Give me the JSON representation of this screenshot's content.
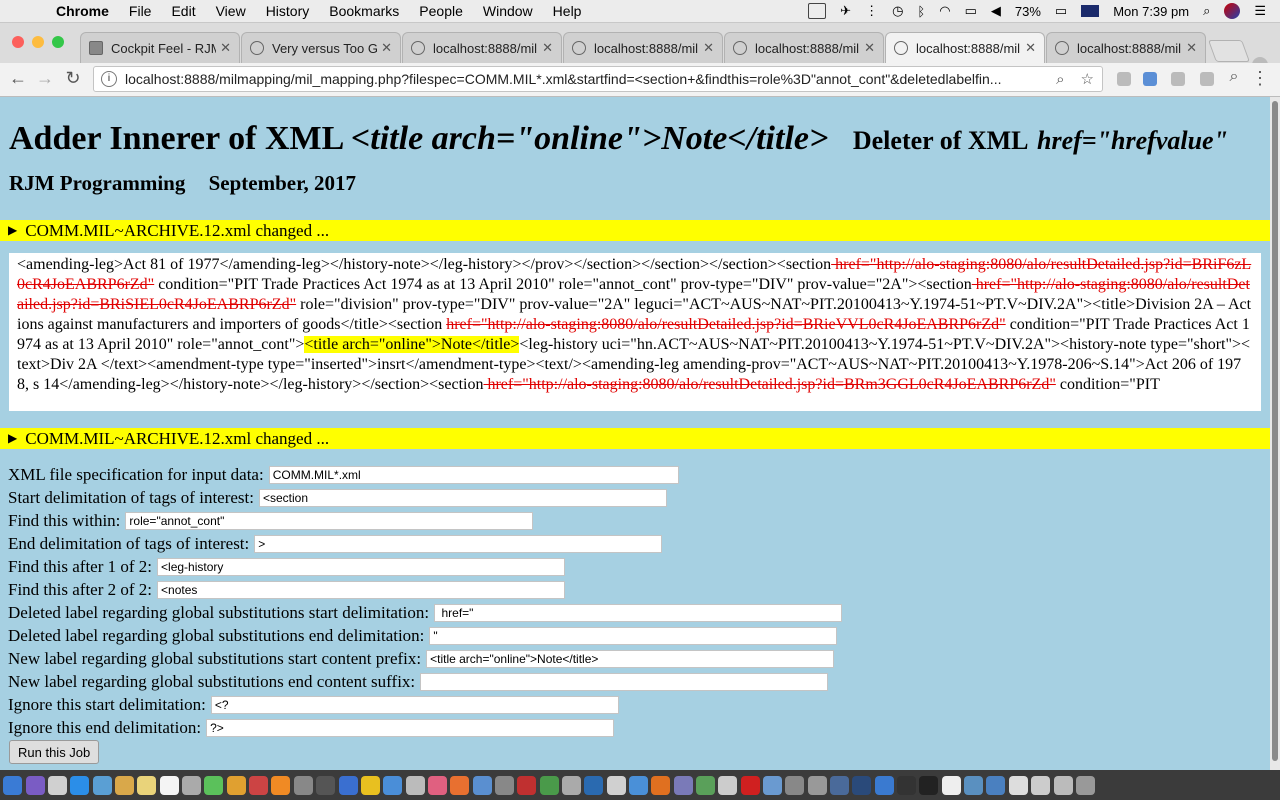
{
  "menubar": {
    "apple": "",
    "app": "Chrome",
    "items": [
      "File",
      "Edit",
      "View",
      "History",
      "Bookmarks",
      "People",
      "Window",
      "Help"
    ],
    "battery": "73%",
    "clock": "Mon 7:39 pm"
  },
  "tabs": [
    {
      "title": "Cockpit Feel - RJM"
    },
    {
      "title": "Very versus Too G"
    },
    {
      "title": "localhost:8888/mil"
    },
    {
      "title": "localhost:8888/mil"
    },
    {
      "title": "localhost:8888/mil"
    },
    {
      "title": "localhost:8888/mil"
    },
    {
      "title": "localhost:8888/mil"
    }
  ],
  "omnibox": {
    "url": "localhost:8888/milmapping/mil_mapping.php?filespec=COMM.MIL*.xml&startfind=<section+&findthis=role%3D\"annot_cont\"&deletedlabelfin..."
  },
  "page": {
    "title_main": "Adder Innerer of XML",
    "title_tag": "<title arch=\"online\">Note</title>",
    "title_deleter": "Deleter of XML",
    "title_href": "href=\"hrefvalue\"",
    "author": "RJM Programming",
    "date": "September, 2017",
    "summary1": "COMM.MIL~ARCHIVE.12.xml changed ...",
    "summary2": "COMM.MIL~ARCHIVE.12.xml changed ...",
    "xml": {
      "p1": "<amending-leg>Act 81 of 1977</amending-leg></history-note></leg-history></prov></section></section></section><section",
      "d1": " href=\"http://alo-staging:8080/alo/resultDetailed.jsp?id=BRiF6zL0cR4JoEABRP6rZd\"",
      "p2": " condition=\"PIT Trade Practices Act 1974 as at 13 April 2010\" role=\"annot_cont\" prov-type=\"DIV\" prov-value=\"2A\"><section",
      "d2": " href=\"http://alo-staging:8080/alo/resultDetailed.jsp?id=BRiSIEL0cR4JoEABRP6rZd\"",
      "p3": " role=\"division\" prov-type=\"DIV\" prov-value=\"2A\" leguci=\"ACT~AUS~NAT~PIT.20100413~Y.1974-51~PT.V~DIV.2A\"><title>Division 2A – Actions against manufacturers and importers of goods</title><section ",
      "d3": "href=\"http://alo-staging:8080/alo/resultDetailed.jsp?id=BRieVVL0cR4JoEABRP6rZd\"",
      "p4": " condition=\"PIT Trade Practices Act 1974 as at 13 April 2010\" role=\"annot_cont\">",
      "h1": "<title arch=\"online\">Note</title>",
      "p5": "<leg-history uci=\"hn.ACT~AUS~NAT~PIT.20100413~Y.1974-51~PT.V~DIV.2A\"><history-note type=\"short\"><text>Div 2A </text><amendment-type type=\"inserted\">insrt</amendment-type><text/><amending-leg amending-prov=\"ACT~AUS~NAT~PIT.20100413~Y.1978-206~S.14\">Act 206 of 1978, s 14</amending-leg></history-note></leg-history></section><section",
      "d4": " href=\"http://alo-staging:8080/alo/resultDetailed.jsp?id=BRm3GGL0cR4JoEABRP6rZd\"",
      "p6": " condition=\"PIT"
    },
    "form": [
      {
        "label": "XML file specification for input data:",
        "value": "COMM.MIL*.xml"
      },
      {
        "label": "Start delimitation of tags of interest:",
        "value": "<section"
      },
      {
        "label": "Find this within:",
        "value": "role=\"annot_cont\""
      },
      {
        "label": "End delimitation of tags of interest:",
        "value": ">"
      },
      {
        "label": "Find this after 1 of 2:",
        "value": "<leg-history"
      },
      {
        "label": "Find this after 2 of 2:",
        "value": "<notes"
      },
      {
        "label": "Deleted label regarding global substitutions start delimitation:",
        "value": " href=\""
      },
      {
        "label": "Deleted label regarding global substitutions end delimitation:",
        "value": "\""
      },
      {
        "label": "New label regarding global substitutions start content prefix:",
        "value": "<title arch=\"online\">Note</title>"
      },
      {
        "label": "New label regarding global substitutions end content suffix:",
        "value": ""
      },
      {
        "label": "Ignore this start delimitation:",
        "value": "<?"
      },
      {
        "label": "Ignore this end delimitation:",
        "value": "?>"
      }
    ],
    "run_button": "Run this Job"
  }
}
